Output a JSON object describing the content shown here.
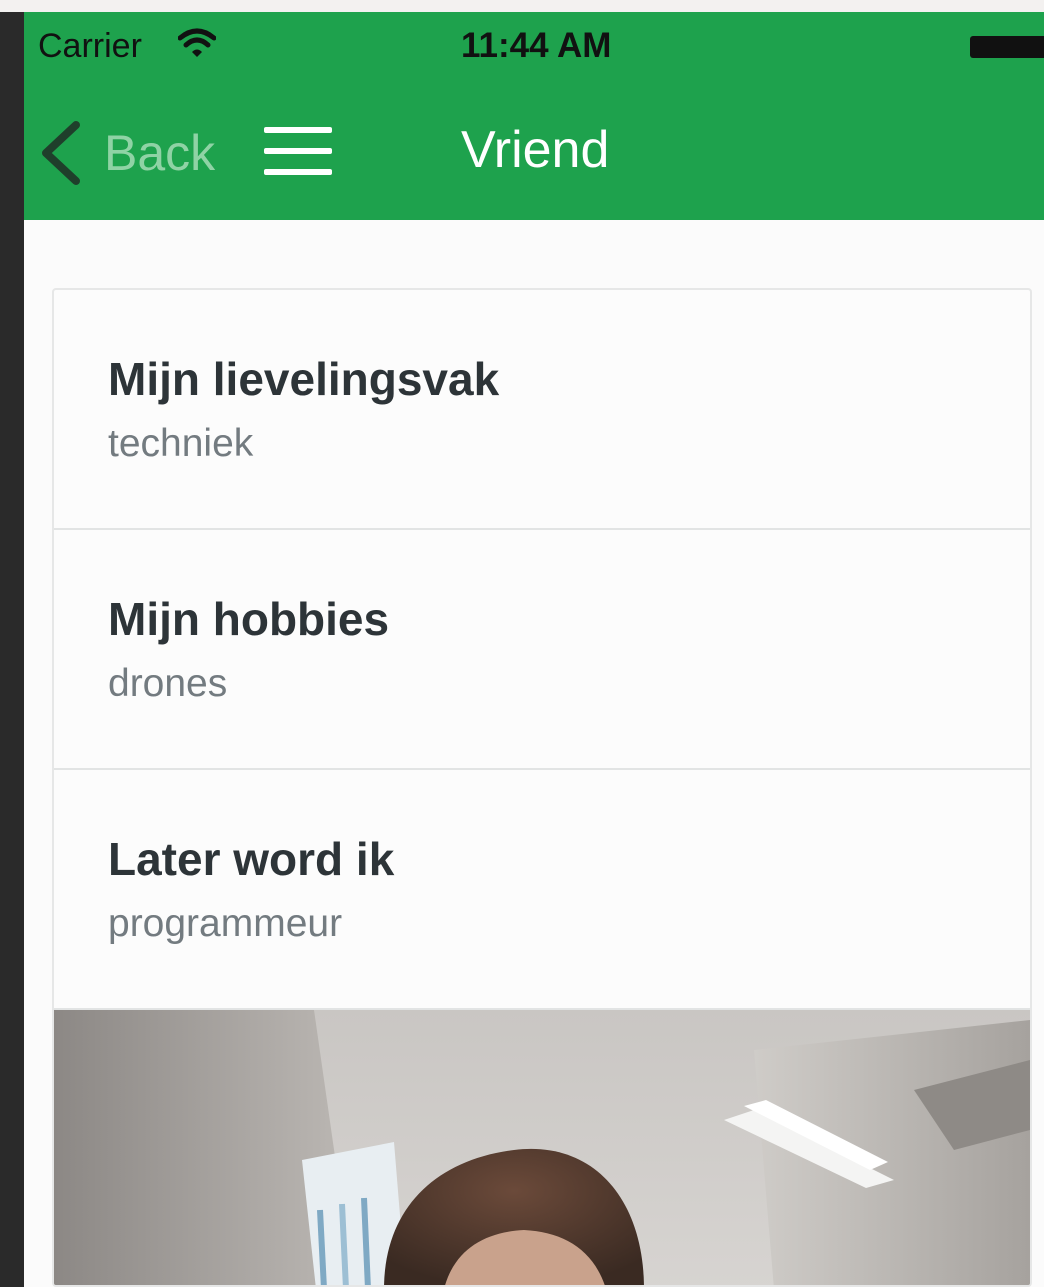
{
  "status_bar": {
    "carrier": "Carrier",
    "time": "11:44 AM",
    "icons": [
      "wifi-icon",
      "battery-icon"
    ]
  },
  "nav_bar": {
    "back_label": "Back",
    "title": "Vriend",
    "icons": [
      "back-chevron-icon",
      "menu-icon"
    ]
  },
  "profile_items": [
    {
      "title": "Mijn lievelingsvak",
      "value": "techniek"
    },
    {
      "title": "Mijn hobbies",
      "value": "drones"
    },
    {
      "title": "Later word ik",
      "value": "programmeur"
    }
  ],
  "colors": {
    "accent_green": "#1ea24d",
    "back_text": "#8fd3a5",
    "title_text": "#2d3438",
    "value_text": "#737b80",
    "card_background": "#fcfcfc"
  }
}
